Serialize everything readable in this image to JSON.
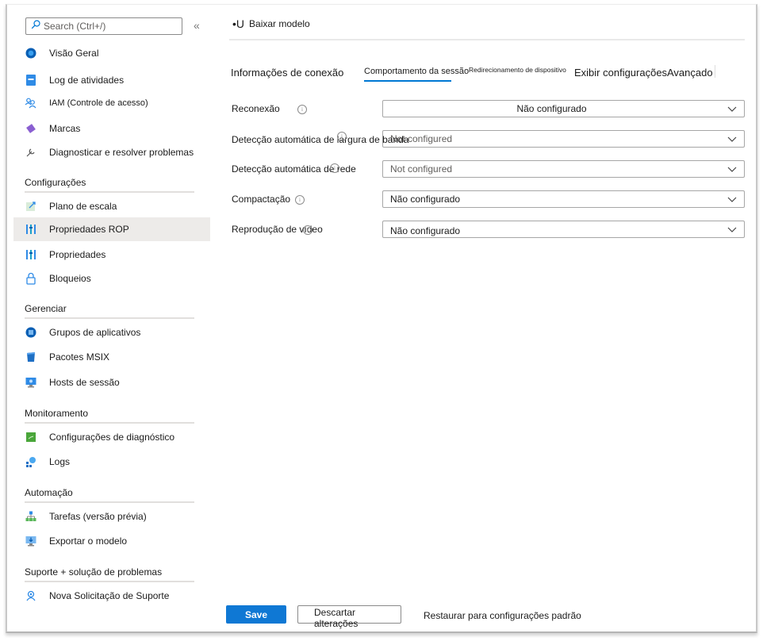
{
  "sidebar": {
    "search_placeholder": "Search (Ctrl+/)",
    "collapse_glyph": "«",
    "top_items": [
      {
        "label": "Visão Geral",
        "icon": "overview-icon"
      },
      {
        "label": "Log de atividades",
        "icon": "activity-log-icon"
      },
      {
        "label": "IAM (Controle de acesso)",
        "icon": "access-control-icon"
      },
      {
        "label": "Marcas",
        "icon": "tag-icon"
      },
      {
        "label": "Diagnosticar e resolver problemas",
        "icon": "wrench-icon"
      }
    ],
    "sections": [
      {
        "title": "Configurações",
        "items": [
          {
            "label": "Plano de escala",
            "icon": "scaling-plan-icon"
          },
          {
            "label": "Propriedades ROP",
            "icon": "properties-icon",
            "active": true
          },
          {
            "label": "Propriedades",
            "icon": "properties-icon"
          },
          {
            "label": "Bloqueios",
            "icon": "lock-icon"
          }
        ]
      },
      {
        "title": "Gerenciar",
        "items": [
          {
            "label": "Grupos de aplicativos",
            "icon": "app-groups-icon"
          },
          {
            "label": "Pacotes MSIX",
            "icon": "msix-package-icon"
          },
          {
            "label": "Hosts de sessão",
            "icon": "session-host-icon"
          }
        ]
      },
      {
        "title": "Monitoramento",
        "items": [
          {
            "label": "Configurações de diagnóstico",
            "icon": "diagnostic-settings-icon"
          },
          {
            "label": "Logs",
            "icon": "logs-icon"
          }
        ]
      },
      {
        "title": "Automação",
        "items": [
          {
            "label": "Tarefas (versão prévia)",
            "icon": "tasks-icon"
          },
          {
            "label": "Exportar o modelo",
            "icon": "export-template-icon"
          }
        ]
      },
      {
        "title": "Suporte + solução de problemas",
        "items": [
          {
            "label": "Nova Solicitação de Suporte",
            "icon": "support-request-icon"
          }
        ]
      }
    ]
  },
  "toolbar": {
    "download_glyph": "•U",
    "download_label": "Baixar modelo"
  },
  "tabs": [
    {
      "label": "Informações de conexão"
    },
    {
      "label": "Comportamento da sessão",
      "active": true
    },
    {
      "label": "Redirecionamento de dispositivo"
    },
    {
      "label": "Exibir configurações"
    },
    {
      "label": "Avançado"
    }
  ],
  "form": {
    "rows": [
      {
        "label": "Reconexão",
        "value": "Não configurado"
      },
      {
        "label": "Detecção automática de largura de banda",
        "value": "Not configured"
      },
      {
        "label": "Detecção automática de rede",
        "value": "Not configured"
      },
      {
        "label": "Compactação",
        "value": "Não configurado"
      },
      {
        "label": "Reprodução de vídeo",
        "value": "Não configurado"
      }
    ],
    "info_glyph": "i"
  },
  "footer": {
    "save_label": "Save",
    "discard_label": "Descartar alterações",
    "restore_label": "Restaurar para configurações padrão"
  },
  "colors": {
    "accent": "#0f78d4",
    "active_nav_bg": "#edebe9"
  }
}
